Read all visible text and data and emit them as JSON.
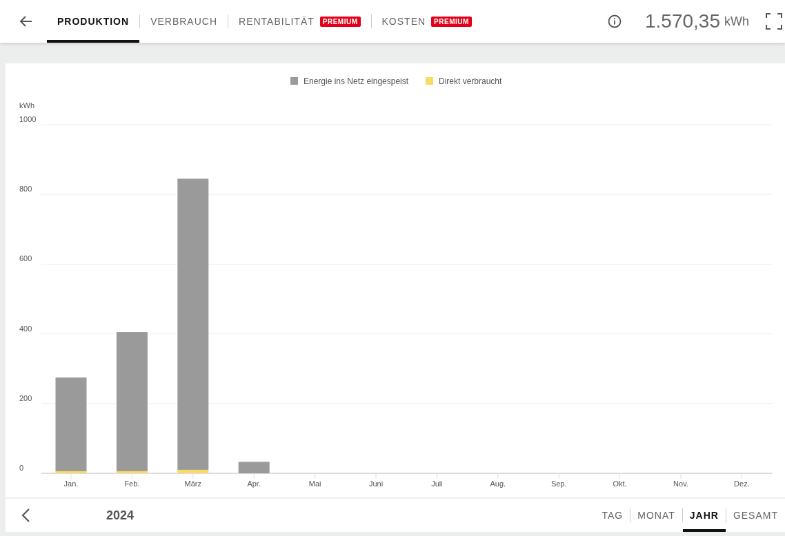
{
  "tabs": [
    {
      "label": "PRODUKTION",
      "selected": true
    },
    {
      "label": "VERBRAUCH",
      "selected": false
    },
    {
      "label": "RENTABILITÄT",
      "selected": false,
      "badge": "PREMIUM"
    },
    {
      "label": "KOSTEN",
      "selected": false,
      "badge": "PREMIUM"
    }
  ],
  "total": {
    "value": "1.570,35",
    "unit": "kWh"
  },
  "chart": {
    "chart_data": {
      "type": "bar",
      "stacked": true,
      "ylabel": "kWh",
      "categories": [
        "Jan.",
        "Feb.",
        "März",
        "Apr.",
        "Mai",
        "Juni",
        "Juli",
        "Aug.",
        "Sep.",
        "Okt.",
        "Nov.",
        "Dez."
      ],
      "series": [
        {
          "name": "Energie ins Netz eingespeist",
          "color": "#9a9a9a",
          "values": [
            269,
            399,
            835,
            33,
            null,
            null,
            null,
            null,
            null,
            null,
            null,
            null
          ]
        },
        {
          "name": "Direkt verbraucht",
          "color": "#fbd965",
          "values": [
            6,
            6,
            10,
            0,
            null,
            null,
            null,
            null,
            null,
            null,
            null,
            null
          ]
        }
      ],
      "grid": true,
      "legend": "top",
      "ylim": [
        0,
        1000
      ],
      "yticks": [
        0,
        200,
        400,
        600,
        800,
        1000
      ]
    }
  },
  "footer": {
    "period": "2024",
    "ranges": [
      {
        "label": "TAG",
        "selected": false
      },
      {
        "label": "MONAT",
        "selected": false
      },
      {
        "label": "JAHR",
        "selected": true
      },
      {
        "label": "GESAMT",
        "selected": false
      }
    ]
  }
}
